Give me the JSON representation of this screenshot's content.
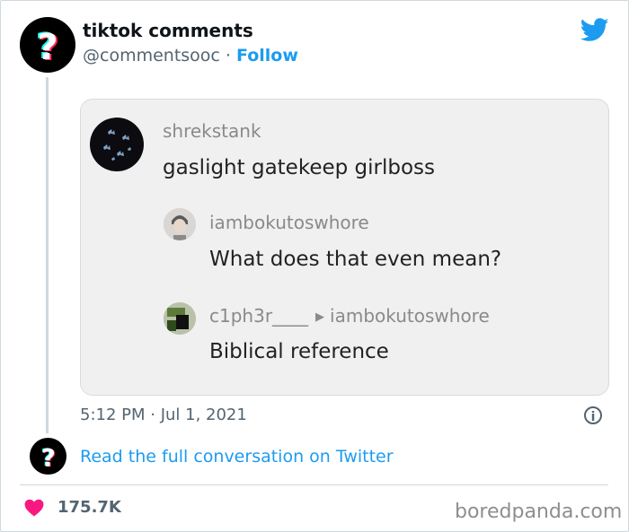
{
  "tweet": {
    "author_name": "tiktok comments",
    "author_handle": "@commentsooc",
    "separator": "·",
    "follow_label": "Follow",
    "avatar_icon": "question-mark-icon",
    "timestamp": "5:12 PM · Jul 1, 2021",
    "read_full_label": "Read the full conversation on Twitter",
    "likes": "175.7K"
  },
  "screenshot": {
    "comment": {
      "user": "shrekstank",
      "text": "gaslight gatekeep girlboss"
    },
    "reply1": {
      "user": "iambokutoswhore",
      "text": "What does that even mean?"
    },
    "reply2": {
      "user": "c1ph3r____",
      "reply_to": "iambokutoswhore",
      "text": "Biblical reference"
    }
  },
  "watermark": "boredpanda.com",
  "colors": {
    "twitter_blue": "#1d9bf0",
    "heart_red": "#f91880",
    "text_secondary": "#536471"
  }
}
